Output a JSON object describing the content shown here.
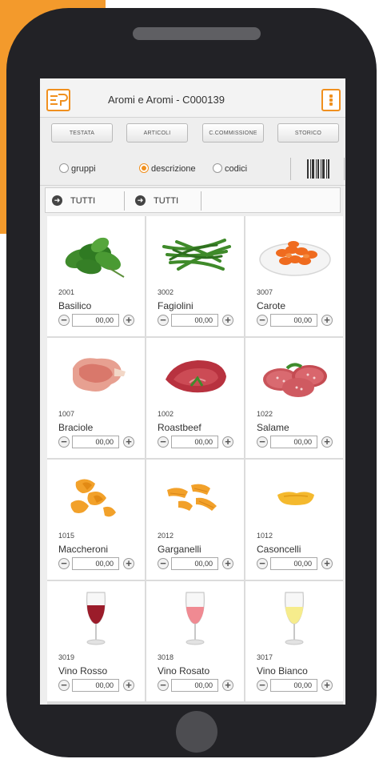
{
  "header": {
    "title": "Aromi e Aromi - C000139",
    "logo_icon": "app-logo-icon",
    "menu_icon": "kebab-menu-icon"
  },
  "tabs": [
    "TESTATA",
    "ARTICOLI",
    "C.COMMISSIONE",
    "STORICO"
  ],
  "filters": {
    "options": [
      "gruppi",
      "descrizione",
      "codici"
    ],
    "selected": "descrizione",
    "barcode_icon": "barcode-icon"
  },
  "selectors": [
    {
      "label": "TUTTI",
      "icon": "arrow-right-circle-icon"
    },
    {
      "label": "TUTTI",
      "icon": "arrow-right-circle-icon"
    }
  ],
  "products": [
    {
      "code": "2001",
      "name": "Basilico",
      "qty": "00,00",
      "image": "basil"
    },
    {
      "code": "3002",
      "name": "Fagiolini",
      "qty": "00,00",
      "image": "green-beans"
    },
    {
      "code": "3007",
      "name": "Carote",
      "qty": "00,00",
      "image": "carrots"
    },
    {
      "code": "1007",
      "name": "Braciole",
      "qty": "00,00",
      "image": "pork-chop"
    },
    {
      "code": "1002",
      "name": "Roastbeef",
      "qty": "00,00",
      "image": "roastbeef"
    },
    {
      "code": "1022",
      "name": "Salame",
      "qty": "00,00",
      "image": "salami"
    },
    {
      "code": "1015",
      "name": "Maccheroni",
      "qty": "00,00",
      "image": "maccheroni"
    },
    {
      "code": "2012",
      "name": "Garganelli",
      "qty": "00,00",
      "image": "garganelli"
    },
    {
      "code": "1012",
      "name": "Casoncelli",
      "qty": "00,00",
      "image": "casoncelli"
    },
    {
      "code": "3019",
      "name": "Vino Rosso",
      "qty": "00,00",
      "image": "red-wine-glass"
    },
    {
      "code": "3018",
      "name": "Vino Rosato",
      "qty": "00,00",
      "image": "rose-wine-glass"
    },
    {
      "code": "3017",
      "name": "Vino Bianco",
      "qty": "00,00",
      "image": "white-wine-glass"
    }
  ],
  "colors": {
    "accent": "#f0901f",
    "background_orange": "#f39a2c",
    "phone_body": "#222226"
  }
}
